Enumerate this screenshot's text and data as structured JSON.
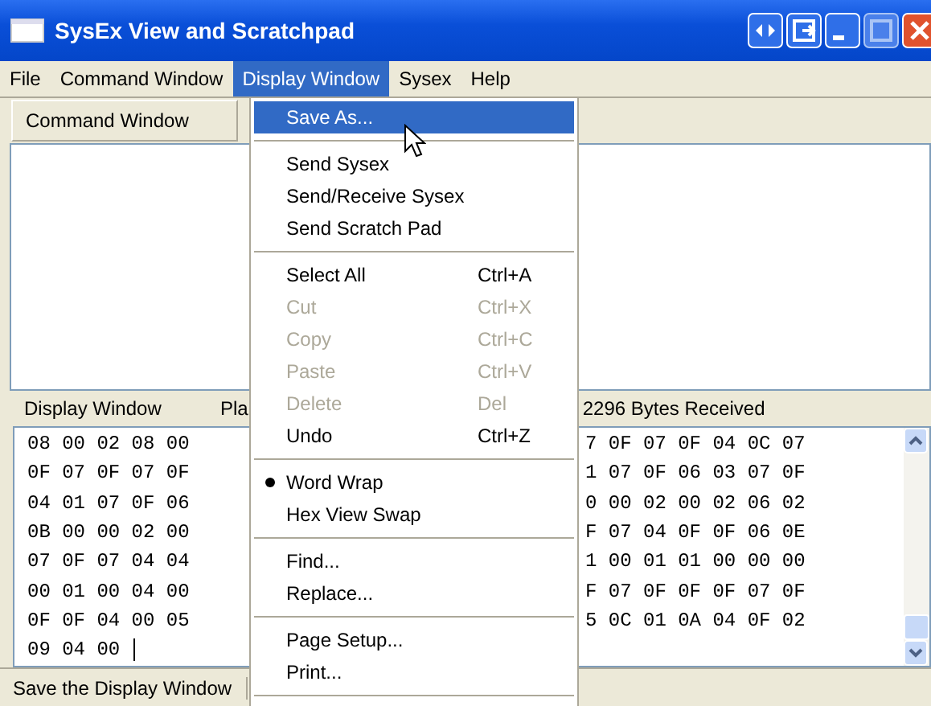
{
  "window": {
    "title": "SysEx View and Scratchpad"
  },
  "menubar": [
    {
      "label": "File",
      "selected": false
    },
    {
      "label": "Command Window",
      "selected": false
    },
    {
      "label": "Display Window",
      "selected": true
    },
    {
      "label": "Sysex",
      "selected": false
    },
    {
      "label": "Help",
      "selected": false
    }
  ],
  "command_window": {
    "header": "Command Window"
  },
  "display_window": {
    "header": "Display Window",
    "column_2": "Pla",
    "bytes": "2296  Bytes Received",
    "rows": [
      {
        "left": "08 00 02 08 00",
        "right": "7 0F 07 0F 04 0C 07"
      },
      {
        "left": "0F 07 0F 07 0F",
        "right": "1 07 0F 06 03 07 0F"
      },
      {
        "left": "04 01 07 0F 06",
        "right": "0 00 02 00 02 06 02"
      },
      {
        "left": "0B 00 00 02 00",
        "right": "F 07 04 0F 0F 06 0E"
      },
      {
        "left": "07 0F 07 04 04",
        "right": "1 00 01 01 00 00 00"
      },
      {
        "left": "00 01 00 04 00",
        "right": "F 07 0F 0F 0F 07 0F"
      },
      {
        "left": "0F 0F 04 00 05",
        "right": "5 0C 01 0A 04 0F 02"
      },
      {
        "left": "09 04 00"
      }
    ]
  },
  "status_bar": "Save the Display Window",
  "menu": [
    {
      "kind": "item",
      "label": "Save As...",
      "selected": true,
      "disabled": false,
      "checked": false
    },
    {
      "kind": "separator"
    },
    {
      "kind": "item",
      "label": "Send Sysex",
      "selected": false,
      "disabled": false,
      "checked": false
    },
    {
      "kind": "item",
      "label": "Send/Receive Sysex",
      "selected": false,
      "disabled": false,
      "checked": false
    },
    {
      "kind": "item",
      "label": "Send Scratch Pad",
      "selected": false,
      "disabled": false,
      "checked": false
    },
    {
      "kind": "separator"
    },
    {
      "kind": "item",
      "label": "Select All",
      "shortcut": "Ctrl+A",
      "selected": false,
      "disabled": false,
      "checked": false
    },
    {
      "kind": "item",
      "label": "Cut",
      "shortcut": "Ctrl+X",
      "selected": false,
      "disabled": true,
      "checked": false
    },
    {
      "kind": "item",
      "label": "Copy",
      "shortcut": "Ctrl+C",
      "selected": false,
      "disabled": true,
      "checked": false
    },
    {
      "kind": "item",
      "label": "Paste",
      "shortcut": "Ctrl+V",
      "selected": false,
      "disabled": true,
      "checked": false
    },
    {
      "kind": "item",
      "label": "Delete",
      "shortcut": "Del",
      "selected": false,
      "disabled": true,
      "checked": false
    },
    {
      "kind": "item",
      "label": "Undo",
      "shortcut": "Ctrl+Z",
      "selected": false,
      "disabled": false,
      "checked": false
    },
    {
      "kind": "separator"
    },
    {
      "kind": "item",
      "label": "Word Wrap",
      "selected": false,
      "disabled": false,
      "checked": true
    },
    {
      "kind": "item",
      "label": "Hex View Swap",
      "selected": false,
      "disabled": false,
      "checked": false
    },
    {
      "kind": "separator"
    },
    {
      "kind": "item",
      "label": "Find...",
      "selected": false,
      "disabled": false,
      "checked": false
    },
    {
      "kind": "item",
      "label": "Replace...",
      "selected": false,
      "disabled": false,
      "checked": false
    },
    {
      "kind": "separator"
    },
    {
      "kind": "item",
      "label": "Page Setup...",
      "selected": false,
      "disabled": false,
      "checked": false
    },
    {
      "kind": "item",
      "label": "Print...",
      "selected": false,
      "disabled": false,
      "checked": false
    },
    {
      "kind": "separator"
    }
  ]
}
